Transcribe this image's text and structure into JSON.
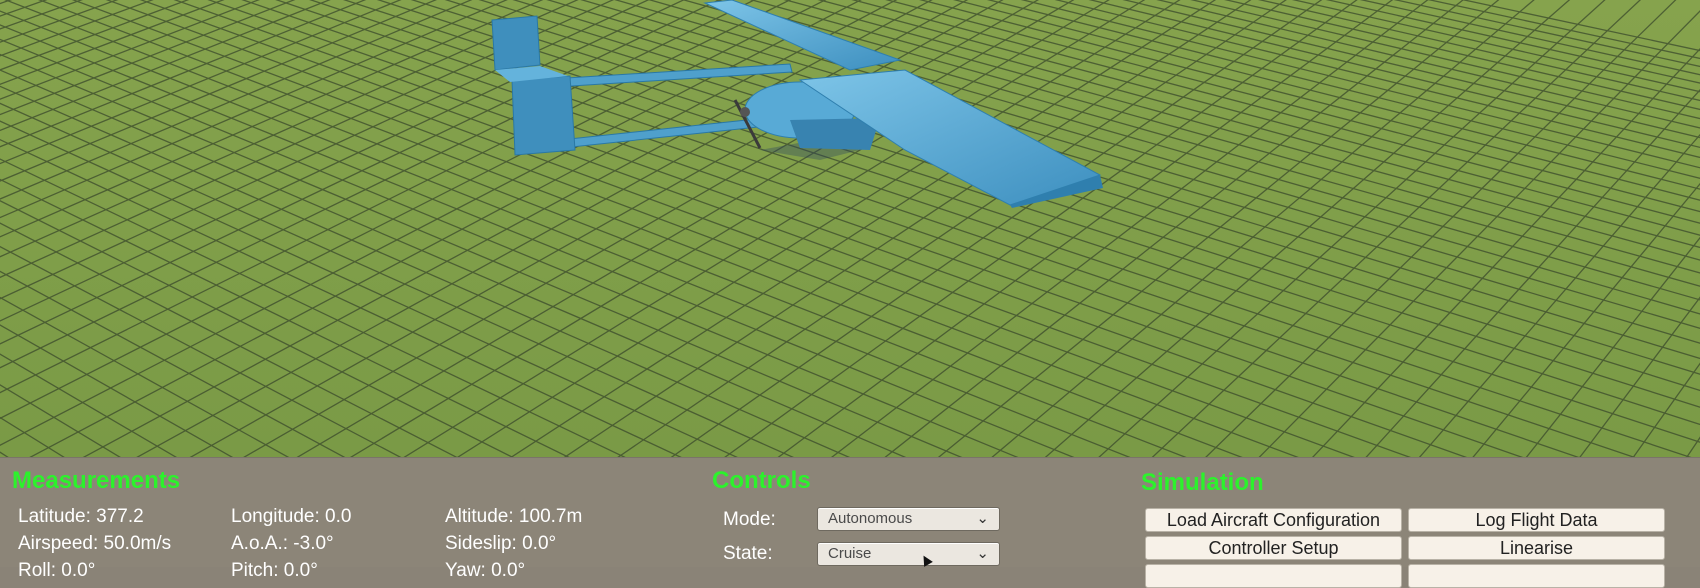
{
  "measurements": {
    "title": "Measurements",
    "latitude": "Latitude: 377.2",
    "longitude": "Longitude: 0.0",
    "altitude": "Altitude: 100.7m",
    "airspeed": "Airspeed: 50.0m/s",
    "aoa": "A.o.A.: -3.0°",
    "sideslip": "Sideslip: 0.0°",
    "roll": "Roll: 0.0°",
    "pitch": "Pitch: 0.0°",
    "yaw": "Yaw: 0.0°"
  },
  "controls": {
    "title": "Controls",
    "mode_label": "Mode:",
    "mode_value": "Autonomous",
    "state_label": "State:",
    "state_value": "Cruise"
  },
  "simulation": {
    "title": "Simulation",
    "buttons": [
      "Load Aircraft Configuration",
      "Log Flight Data",
      "Controller Setup",
      "Linearise"
    ]
  },
  "colors": {
    "section_title": "#2cf22c",
    "ground": "#7e9c47",
    "grid_lines": "#39452a",
    "aircraft": "#56a9d4",
    "panel": "#8c8578"
  }
}
